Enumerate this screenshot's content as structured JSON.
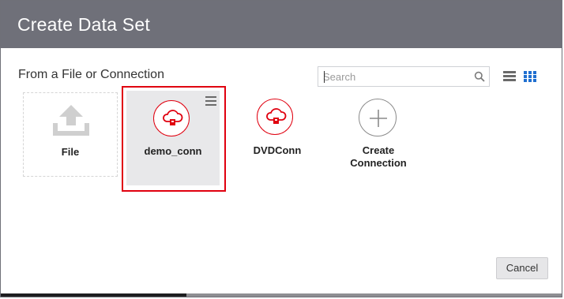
{
  "dialog": {
    "title": "Create Data Set",
    "section_label": "From a File or Connection",
    "cancel_label": "Cancel"
  },
  "search": {
    "placeholder": "Search",
    "value": ""
  },
  "view_toggle": {
    "list_icon": "list-view-icon",
    "grid_icon": "grid-view-icon",
    "active": "grid"
  },
  "tiles": [
    {
      "label": "File",
      "icon": "upload-icon"
    },
    {
      "label": "demo_conn",
      "icon": "cloud-connection-icon",
      "selected": true
    },
    {
      "label": "DVDConn",
      "icon": "cloud-connection-icon"
    },
    {
      "label": "Create Connection",
      "label_line1": "Create",
      "label_line2": "Connection",
      "icon": "plus-icon"
    }
  ],
  "colors": {
    "titlebar": "#6f7079",
    "accent_red": "#e0000f",
    "grid_active": "#1f6fd0",
    "selected_tile_bg": "#e8e8ea"
  }
}
